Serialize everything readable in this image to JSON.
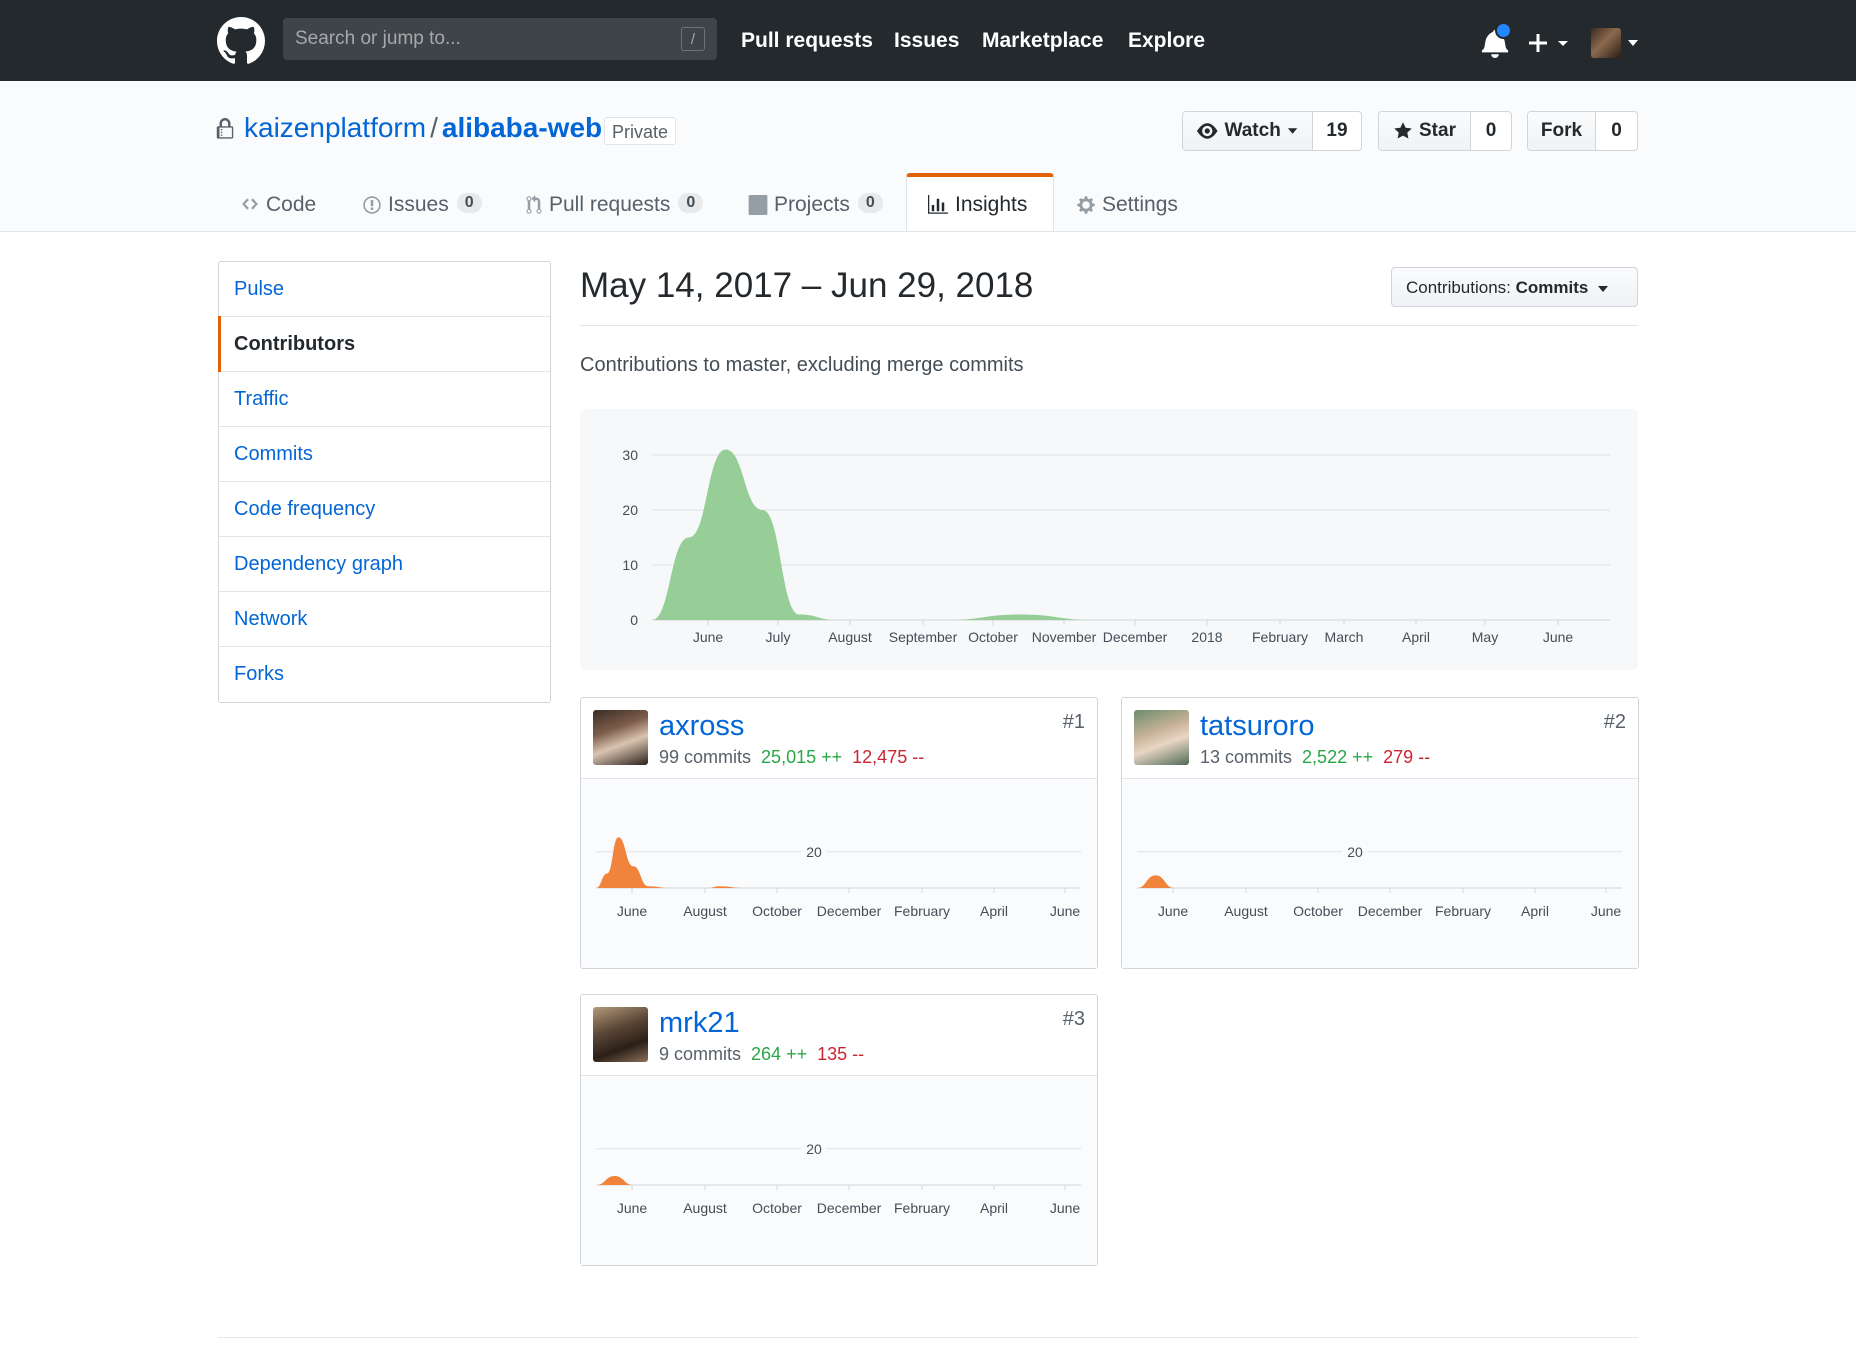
{
  "header": {
    "search_placeholder": "Search or jump to...",
    "search_shortcut": "/",
    "nav": [
      "Pull requests",
      "Issues",
      "Marketplace",
      "Explore"
    ]
  },
  "repo": {
    "owner": "kaizenplatform",
    "separator": "/",
    "name": "alibaba-web",
    "visibility": "Private",
    "watch_label": "Watch",
    "watch_count": "19",
    "star_label": "Star",
    "star_count": "0",
    "fork_label": "Fork",
    "fork_count": "0"
  },
  "tabs": [
    {
      "label": "Code",
      "count": null
    },
    {
      "label": "Issues",
      "count": "0"
    },
    {
      "label": "Pull requests",
      "count": "0"
    },
    {
      "label": "Projects",
      "count": "0"
    },
    {
      "label": "Insights",
      "count": null,
      "selected": true
    },
    {
      "label": "Settings",
      "count": null
    }
  ],
  "sidebar": {
    "items": [
      "Pulse",
      "Contributors",
      "Traffic",
      "Commits",
      "Code frequency",
      "Dependency graph",
      "Network",
      "Forks"
    ],
    "active": "Contributors"
  },
  "main": {
    "date_range": "May 14, 2017 – Jun 29, 2018",
    "contributions_prefix": "Contributions: ",
    "contributions_value": "Commits",
    "subtitle": "Contributions to master, excluding merge commits"
  },
  "chart_data": [
    {
      "type": "area",
      "color": "#97ce97",
      "y_ticks": [
        "0",
        "10",
        "20",
        "30"
      ],
      "ylim": [
        0,
        30
      ],
      "x_ticks": [
        "June",
        "July",
        "August",
        "September",
        "October",
        "November",
        "December",
        "2018",
        "February",
        "March",
        "April",
        "May",
        "June"
      ],
      "x": [
        0,
        0.5,
        1,
        1.5,
        2,
        2.5,
        3,
        3.5,
        4,
        5,
        6,
        7,
        8,
        9,
        10,
        11,
        12,
        13
      ],
      "values": [
        0,
        15,
        31,
        20,
        1,
        0,
        0,
        0,
        0,
        1,
        0,
        0,
        0,
        0,
        0,
        0,
        0,
        0
      ]
    },
    {
      "type": "area",
      "contributor": "axross",
      "color": "#f0843c",
      "y_ticks": [
        "20"
      ],
      "x_ticks": [
        "June",
        "August",
        "October",
        "December",
        "February",
        "April",
        "June"
      ],
      "x": [
        0,
        0.3,
        0.6,
        1,
        1.4,
        2,
        3,
        3.3,
        4,
        13
      ],
      "values": [
        0,
        8,
        28,
        12,
        1,
        0,
        0,
        1,
        0,
        0
      ]
    },
    {
      "type": "area",
      "contributor": "tatsuroro",
      "color": "#f0843c",
      "y_ticks": [
        "20"
      ],
      "x_ticks": [
        "June",
        "August",
        "October",
        "December",
        "February",
        "April",
        "June"
      ],
      "x": [
        0,
        0.5,
        1,
        13
      ],
      "values": [
        0,
        7,
        0,
        0
      ]
    },
    {
      "type": "area",
      "contributor": "mrk21",
      "color": "#f0843c",
      "y_ticks": [
        "20"
      ],
      "x_ticks": [
        "June",
        "August",
        "October",
        "December",
        "February",
        "April",
        "June"
      ],
      "x": [
        0,
        0.5,
        1,
        13
      ],
      "values": [
        0,
        5,
        0,
        0
      ]
    }
  ],
  "contributors": [
    {
      "name": "axross",
      "commits": "99 commits",
      "additions": "25,015 ++",
      "deletions": "12,475 --",
      "rank": "#1"
    },
    {
      "name": "tatsuroro",
      "commits": "13 commits",
      "additions": "2,522 ++",
      "deletions": "279 --",
      "rank": "#2"
    },
    {
      "name": "mrk21",
      "commits": "9 commits",
      "additions": "264 ++",
      "deletions": "135 --",
      "rank": "#3"
    }
  ]
}
